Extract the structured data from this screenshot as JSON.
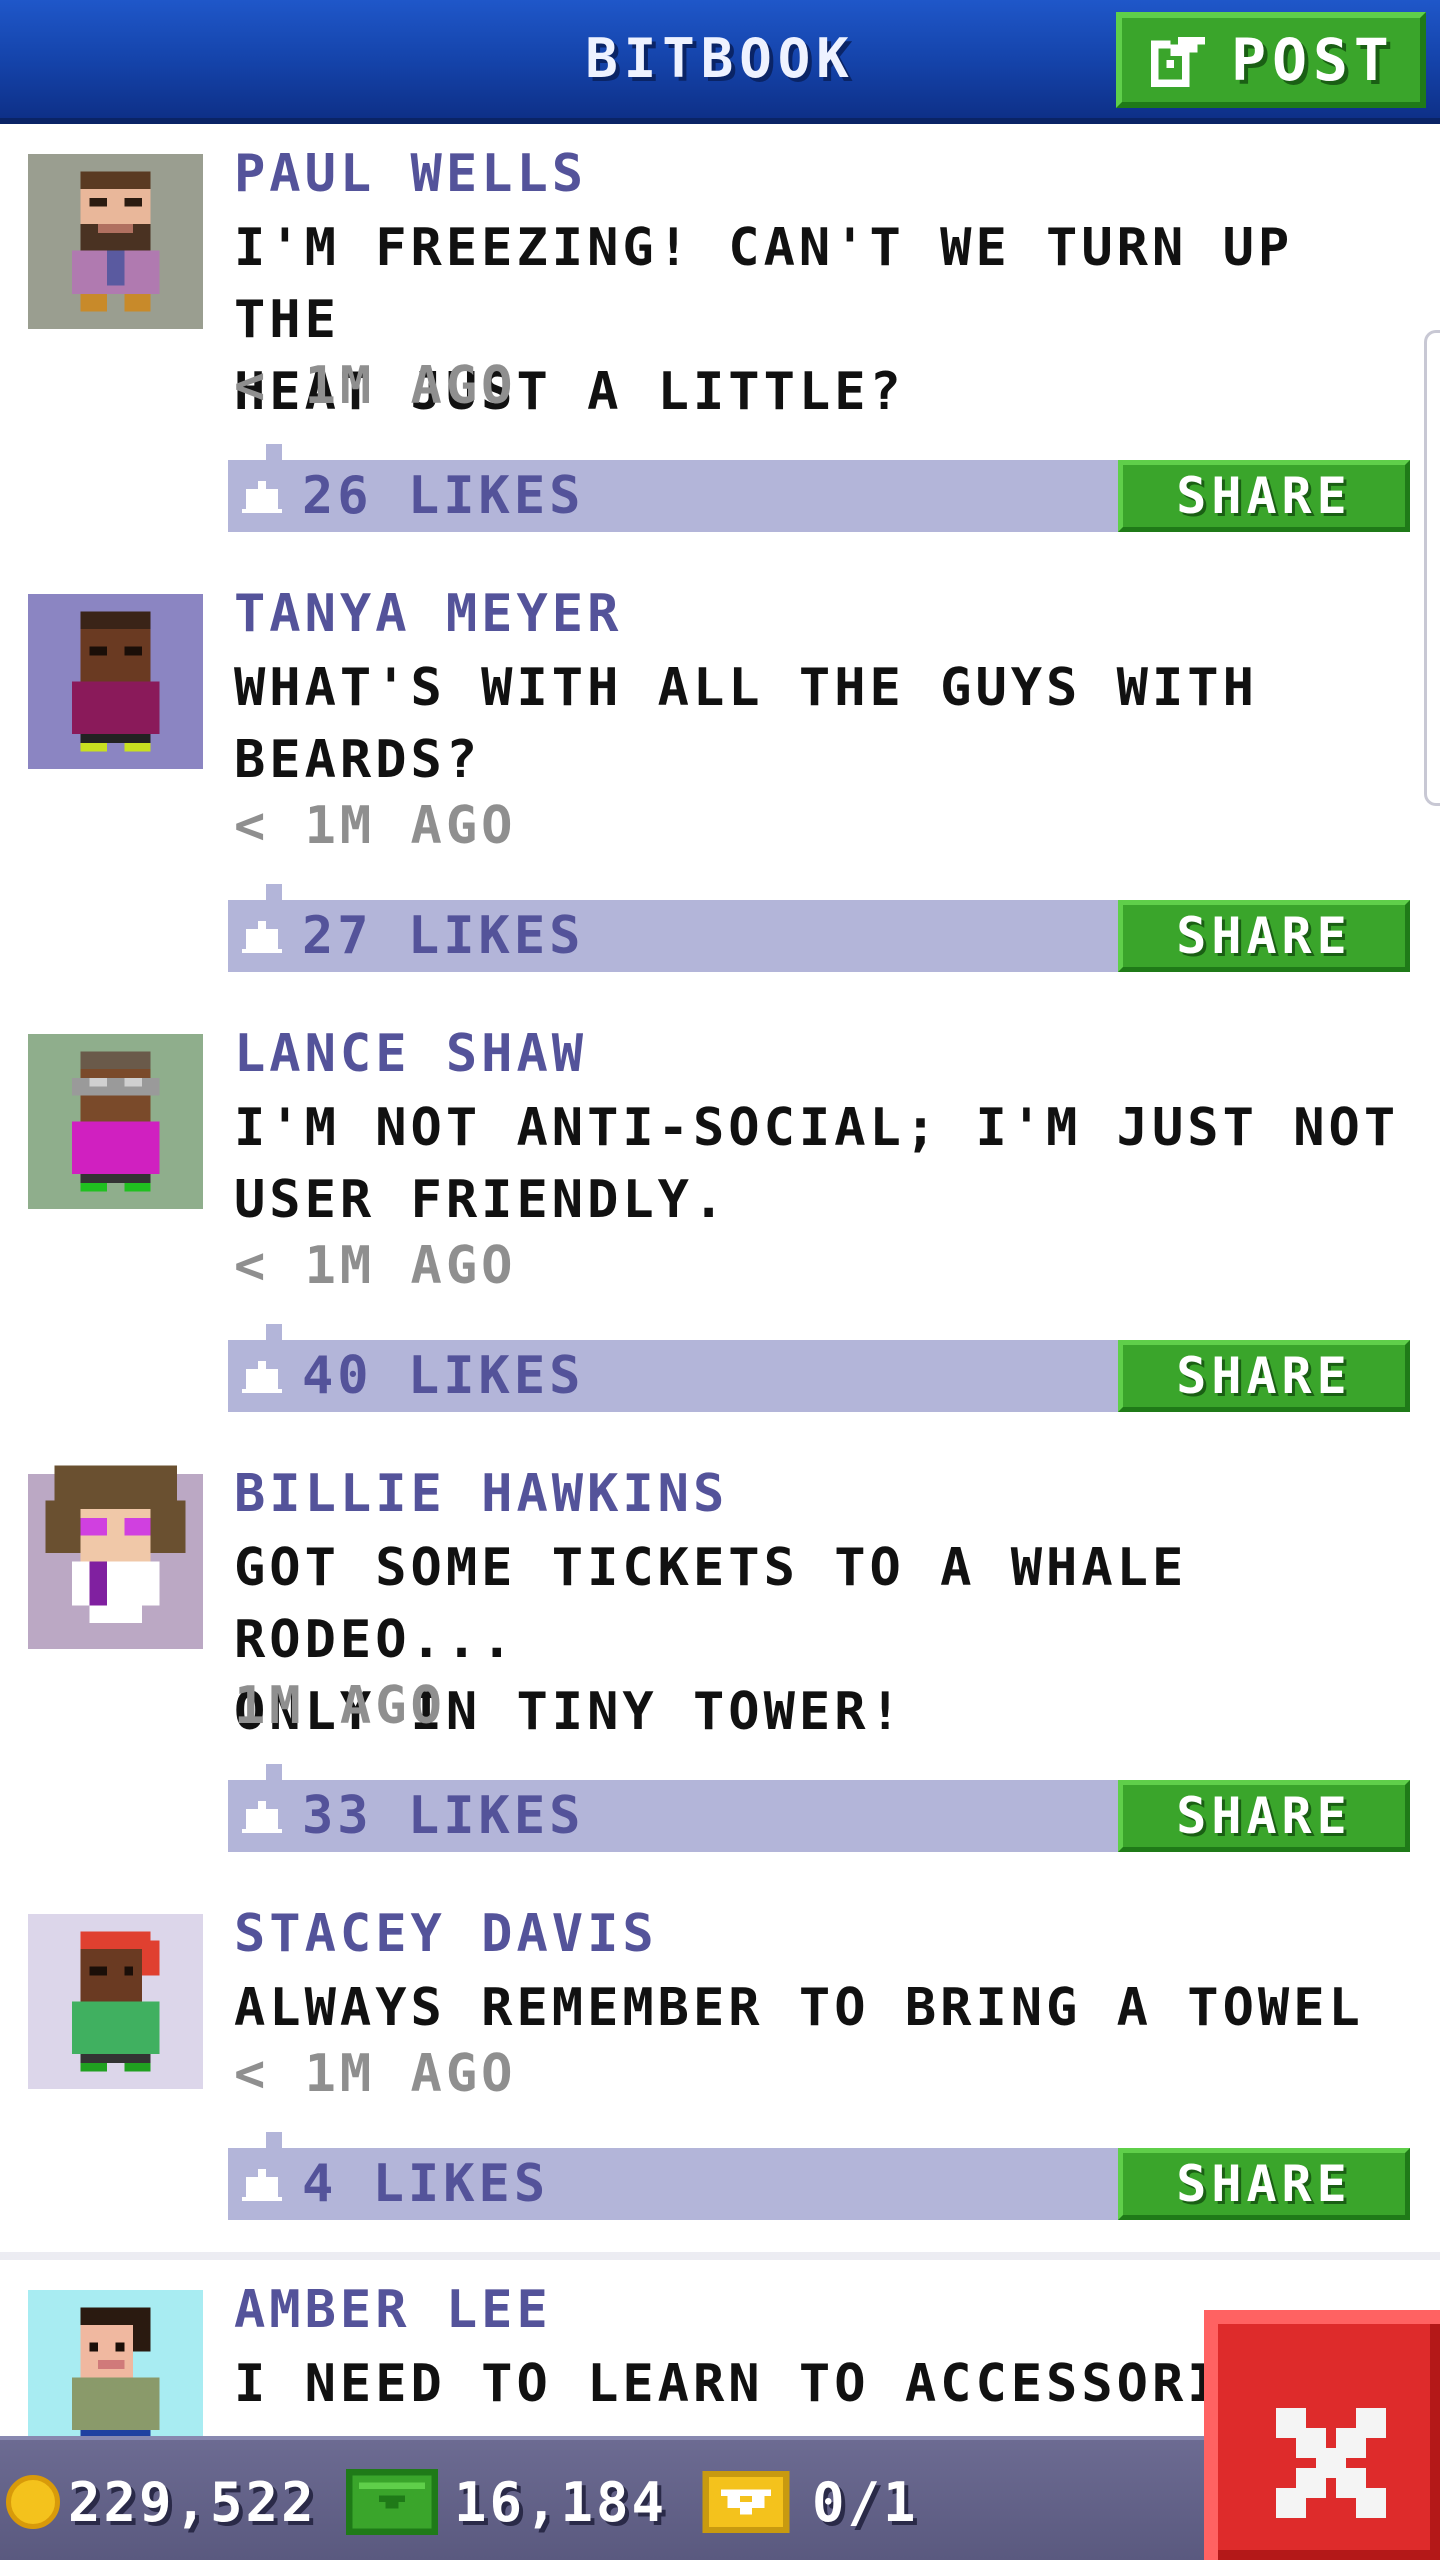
{
  "header": {
    "title": "BITBOOK",
    "post_label": "POST"
  },
  "posts": [
    {
      "author": "PAUL WELLS",
      "message": "I'M FREEZING! CAN'T WE TURN UP THE\nHEAT JUST A LITTLE?",
      "time": "< 1M AGO",
      "likes": "26 LIKES",
      "share_label": "SHARE",
      "avatar_bg": "#9a9e90"
    },
    {
      "author": "TANYA MEYER",
      "message": "WHAT'S WITH ALL THE GUYS WITH\nBEARDS?",
      "time": "< 1M AGO",
      "likes": "27 LIKES",
      "share_label": "SHARE",
      "avatar_bg": "#8b85c2"
    },
    {
      "author": "LANCE SHAW",
      "message": "I'M NOT ANTI-SOCIAL; I'M JUST NOT\nUSER FRIENDLY.",
      "time": "< 1M AGO",
      "likes": "40 LIKES",
      "share_label": "SHARE",
      "avatar_bg": "#8fae8c"
    },
    {
      "author": "BILLIE HAWKINS",
      "message": "GOT SOME TICKETS TO A WHALE RODEO...\nONLY IN TINY TOWER!",
      "time": "1M AGO",
      "likes": "33 LIKES",
      "share_label": "SHARE",
      "avatar_bg": "#bba8c4"
    },
    {
      "author": "STACEY DAVIS",
      "message": "ALWAYS REMEMBER TO BRING A TOWEL",
      "time": "< 1M AGO",
      "likes": "4 LIKES",
      "share_label": "SHARE",
      "avatar_bg": "#dcd6ea"
    },
    {
      "author": "AMBER LEE",
      "message": "I NEED TO LEARN TO ACCESSORIZ",
      "time": "",
      "likes": "",
      "share_label": "",
      "avatar_bg": "#a8ecf2"
    }
  ],
  "status": {
    "coins": "229,522",
    "bux": "16,184",
    "tickets": "0/1"
  },
  "icons": {
    "post": "compose-icon",
    "like": "thumbs-up-icon",
    "coin": "coin-icon",
    "bux": "bux-icon",
    "ticket": "ticket-icon",
    "close": "close-icon"
  },
  "colors": {
    "header": "#1442a8",
    "share": "#3aa52b",
    "like_bar": "#b3b5d9",
    "author": "#54539a",
    "close": "#de2b2b"
  }
}
